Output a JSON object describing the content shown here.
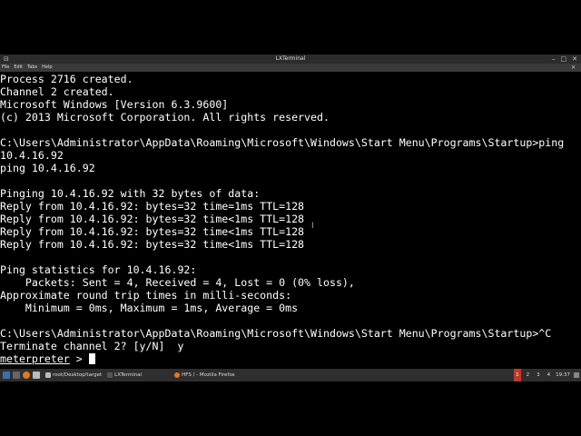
{
  "window": {
    "title": "LXTerminal"
  },
  "menu": [
    "File",
    "Edit",
    "Tabs",
    "Help"
  ],
  "terminal": {
    "lines": [
      "Process 2716 created.",
      "Channel 2 created.",
      "Microsoft Windows [Version 6.3.9600]",
      "(c) 2013 Microsoft Corporation. All rights reserved.",
      "",
      "C:\\Users\\Administrator\\AppData\\Roaming\\Microsoft\\Windows\\Start Menu\\Programs\\Startup>ping",
      "10.4.16.92",
      "ping 10.4.16.92",
      "",
      "Pinging 10.4.16.92 with 32 bytes of data:",
      "Reply from 10.4.16.92: bytes=32 time=1ms TTL=128",
      "Reply from 10.4.16.92: bytes=32 time<1ms TTL=128",
      "Reply from 10.4.16.92: bytes=32 time<1ms TTL=128",
      "Reply from 10.4.16.92: bytes=32 time<1ms TTL=128",
      "",
      "Ping statistics for 10.4.16.92:",
      "    Packets: Sent = 4, Received = 4, Lost = 0 (0% loss),",
      "Approximate round trip times in milli-seconds:",
      "    Minimum = 0ms, Maximum = 1ms, Average = 0ms",
      "",
      "C:\\Users\\Administrator\\AppData\\Roaming\\Microsoft\\Windows\\Start Menu\\Programs\\Startup>^C",
      "Terminate channel 2? [y/N]  y"
    ],
    "prompt": "meterpreter",
    "prompt_suffix": " > "
  },
  "taskbar": {
    "tasks": [
      "root/Desktop/target",
      "LXTerminal",
      "HFS / - Mozilla Firefox"
    ],
    "workspaces": [
      "1",
      "2",
      "3",
      "4"
    ],
    "active_workspace": "1",
    "clock": "19:37"
  }
}
